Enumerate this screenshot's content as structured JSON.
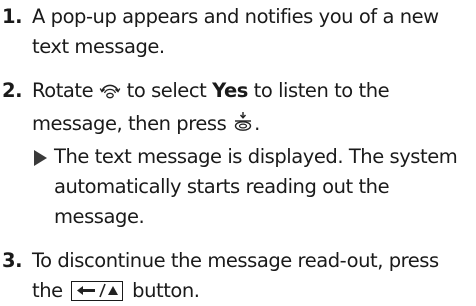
{
  "steps": [
    {
      "number": "1.",
      "text": "A pop-up appears and notifies you of a new text message."
    },
    {
      "number": "2.",
      "text_before": "Rotate",
      "text_mid1": "to select",
      "bold": "Yes",
      "text_mid2": "to listen to the message, then press",
      "text_end": ".",
      "icons": [
        "rotate-knob-icon",
        "press-knob-icon"
      ],
      "result": "The text message is displayed. The system automatically starts reading out the message."
    },
    {
      "number": "3.",
      "text_before": "To discontinue the message read-out, press the",
      "text_after": "button.",
      "icons": [
        "back-button-icon"
      ]
    }
  ]
}
